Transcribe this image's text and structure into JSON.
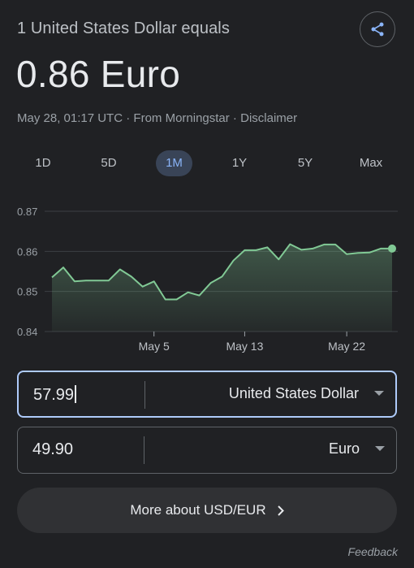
{
  "header": {
    "subtitle": "1 United States Dollar equals",
    "rate": "0.86 Euro",
    "timestamp": "May 28, 01:17 UTC",
    "sep1": " · ",
    "source": "From Morningstar",
    "sep2": " · ",
    "disclaimer": "Disclaimer",
    "share_icon": "share-icon"
  },
  "tabs": [
    {
      "label": "1D",
      "active": false
    },
    {
      "label": "5D",
      "active": false
    },
    {
      "label": "1M",
      "active": true
    },
    {
      "label": "1Y",
      "active": false
    },
    {
      "label": "5Y",
      "active": false
    },
    {
      "label": "Max",
      "active": false
    }
  ],
  "chart_data": {
    "type": "area",
    "ylim": [
      0.84,
      0.87
    ],
    "yticks": [
      "0.87",
      "0.86",
      "0.85",
      "0.84"
    ],
    "ytick_values": [
      0.87,
      0.86,
      0.85,
      0.84
    ],
    "xticks": [
      {
        "label": "May 5",
        "x": 9
      },
      {
        "label": "May 13",
        "x": 17
      },
      {
        "label": "May 22",
        "x": 26
      }
    ],
    "x": [
      0,
      1,
      2,
      3,
      4,
      5,
      6,
      7,
      8,
      9,
      10,
      11,
      12,
      13,
      14,
      15,
      16,
      17,
      18,
      19,
      20,
      21,
      22,
      23,
      24,
      25,
      26,
      27,
      28,
      29,
      30
    ],
    "values": [
      0.8535,
      0.856,
      0.8525,
      0.8527,
      0.8527,
      0.8527,
      0.8555,
      0.8537,
      0.8512,
      0.8525,
      0.848,
      0.848,
      0.8498,
      0.849,
      0.8521,
      0.8537,
      0.8577,
      0.8603,
      0.8603,
      0.861,
      0.858,
      0.8618,
      0.8604,
      0.8607,
      0.8617,
      0.8617,
      0.8593,
      0.8596,
      0.8597,
      0.8607,
      0.8607
    ],
    "line_color": "#81c995",
    "grid": true
  },
  "converter": {
    "from_amount": "57.99",
    "from_currency": "United States Dollar",
    "to_amount": "49.90",
    "to_currency": "Euro"
  },
  "more_button": "More about USD/EUR",
  "feedback": "Feedback"
}
